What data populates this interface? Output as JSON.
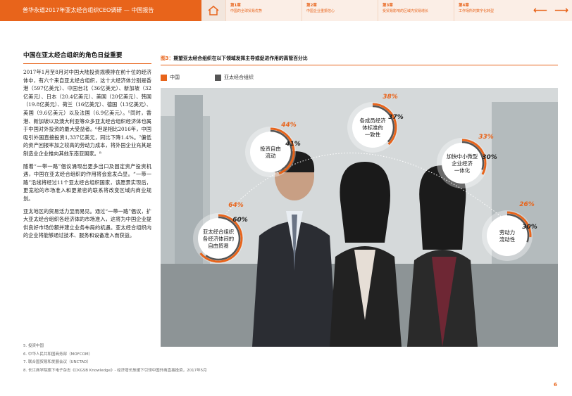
{
  "header": {
    "title": "普华永道2017年亚太经合组织CEO调研 — 中国报告",
    "chapters": [
      {
        "num": "第1章",
        "title": "中国的全球贸易优势"
      },
      {
        "num": "第2章",
        "title": "中国企业重振信心"
      },
      {
        "num": "第3章",
        "title": "受贸易影响的区域内贸易增长"
      },
      {
        "num": "第4章",
        "title": "工作场所的数字化转型"
      }
    ],
    "prev_arrow": "⟵",
    "next_arrow": "⟶",
    "home_icon": "home-icon"
  },
  "left": {
    "section_title": "中国在亚太经合组织的角色日益重要",
    "paragraphs": [
      "2017年1月至8月对中国大陆投资规模排在前十位的经济体中，有六个来自亚太经合组织，这十大经济体分别是香港（597亿美元）、中国台北（36亿美元）、新加坡（32亿美元）、日本（20.4亿美元）、美国（20亿美元）、韩国（19.8亿美元）、荷兰（16亿美元）、德国（13亿美元）、英国（9.6亿美元）以及法国（6.9亿美元）。⁵同时，香港、新加坡以及澳大利亚等众多亚太经合组织经济体也属于中国对外投资的最大受益者。⁶但是相比2016年，中国吸引外国直接投资1,337亿美元，同比下降1.4%。⁷偏低的资产回报率加之较高的劳动力成本，将外国企业充其是制造业企业推向其他东南亚国家。⁸",
      "随着“一带一路”倡议涌现出更多出口及固定资产投资机遇，中国在亚太经合组织的作用将会愈发凸显。“一带一路”沿线将经过11个亚太经合组织国家，该愿景实现后，更宽松的市场准入和更紧密的联系将改变区域内商业规划。",
      "亚太地区的贸易活力显而易见。通过“一带一路”倡议，扩大亚太经合组织各经济体的市场准入，这将为中国企业提供良好市场份额并建立业务布局的机遇。亚太经合组织内的企业将能够通过技术、服务和设备准入而获益。"
    ]
  },
  "footnotes": [
    "5. 投资中国",
    "6. 中华人民共和国商务部（MOFCOM）",
    "7. 联合国贸易和发展会议（UNCTAD）",
    "8. 长江商学院旗下电子杂志《CKGSB Knowledge》- 经济增长放缓下引领中国外商直接投资，2017年5月"
  ],
  "figure": {
    "label": "图3：",
    "title": "期望亚太经合组织在以下领域发挥主导或促进作用的高管百分比",
    "legend": [
      {
        "name": "中国",
        "color": "#e8641b"
      },
      {
        "name": "亚太经合组织",
        "color": "#555555"
      }
    ]
  },
  "chart_data": {
    "type": "bubble-radial",
    "series_names": [
      "中国",
      "亚太经合组织"
    ],
    "categories": [
      "亚太经合组织各经济体间的自由贸易",
      "投资自由流动",
      "各成员经济体标准的一致性",
      "加快中小微型企业经济一体化",
      "劳动力流动性"
    ],
    "china": [
      64,
      44,
      38,
      33,
      26
    ],
    "apec": [
      60,
      41,
      37,
      30,
      30
    ],
    "colors": {
      "china": "#e8641b",
      "apec": "#555555"
    }
  },
  "page_number": "6"
}
